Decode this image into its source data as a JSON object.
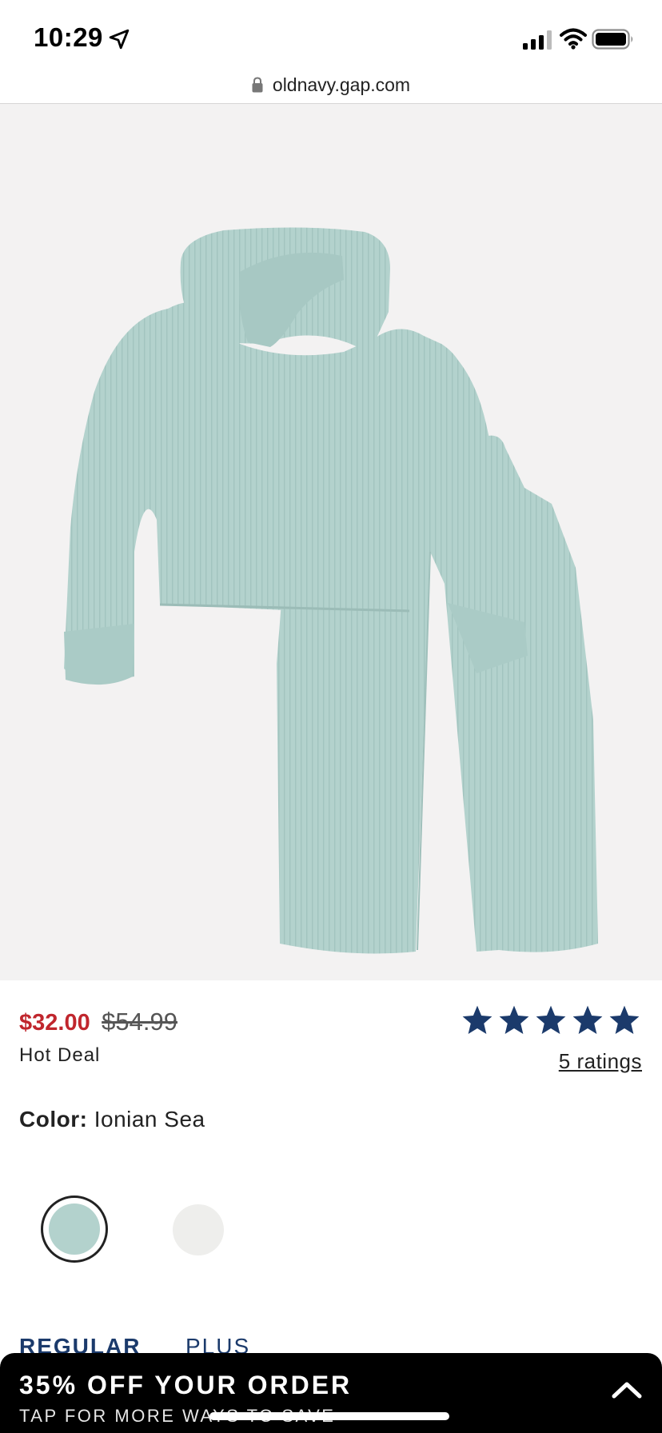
{
  "status_bar": {
    "time": "10:29"
  },
  "browser": {
    "url": "oldnavy.gap.com"
  },
  "gallery": {
    "image_count": 2,
    "active_index": 0
  },
  "product": {
    "sale_price": "$32.00",
    "original_price": "$54.99",
    "deal_label": "Hot Deal",
    "rating_stars": 5,
    "ratings_link": "5 ratings"
  },
  "color": {
    "label": "Color:",
    "selected": "Ionian Sea",
    "swatches": [
      {
        "color": "#b3d2cd",
        "selected": true
      },
      {
        "color": "#eeeeec",
        "selected": false
      }
    ]
  },
  "fit_tabs": {
    "regular": "REGULAR",
    "plus": "PLUS"
  },
  "promo": {
    "title": "35% OFF YOUR ORDER",
    "subtitle": "TAP FOR MORE WAYS TO SAVE"
  },
  "colors": {
    "sale": "#c0262d",
    "brand_navy": "#1b3a6b",
    "garment": "#b3d2cd"
  }
}
